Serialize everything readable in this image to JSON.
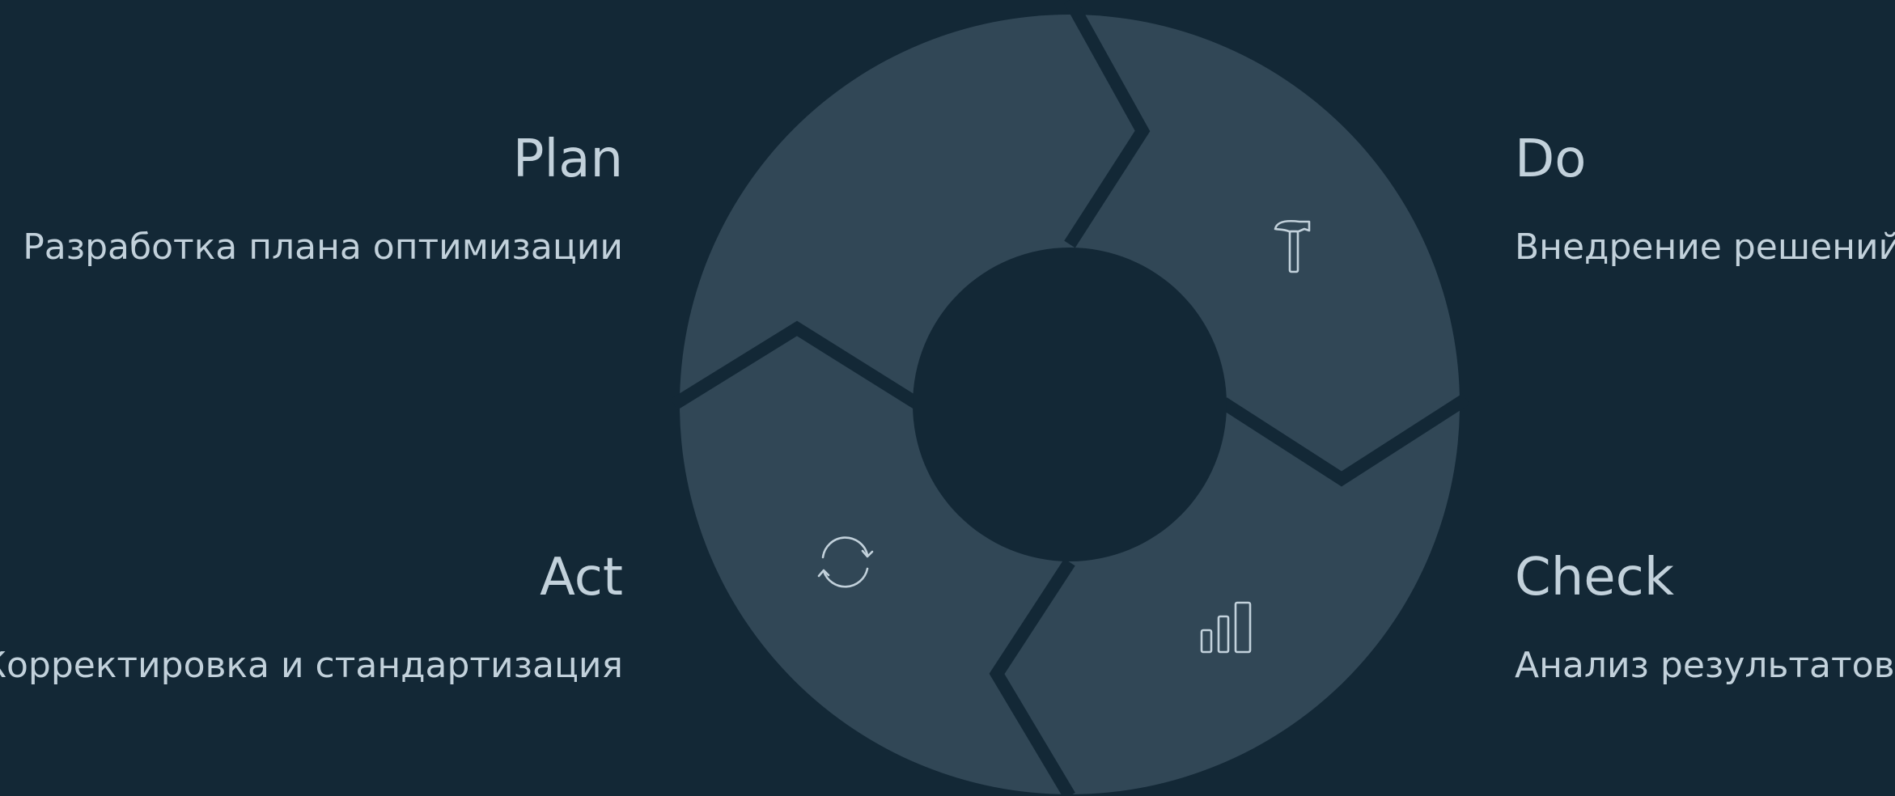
{
  "colors": {
    "background": "#132836",
    "segment": "#314756",
    "icon_stroke": "#c2d1db",
    "text": "#c2d1db"
  },
  "stages": {
    "plan": {
      "title": "Plan",
      "description": "Разработка плана оптимизации"
    },
    "do": {
      "title": "Do",
      "description": "Внедрение решений",
      "icon": "hammer-icon"
    },
    "check": {
      "title": "Check",
      "description": "Анализ результатов",
      "icon": "bar-chart-icon"
    },
    "act": {
      "title": "Act",
      "description": "Корректировка и стандартизация",
      "icon": "refresh-icon"
    }
  }
}
